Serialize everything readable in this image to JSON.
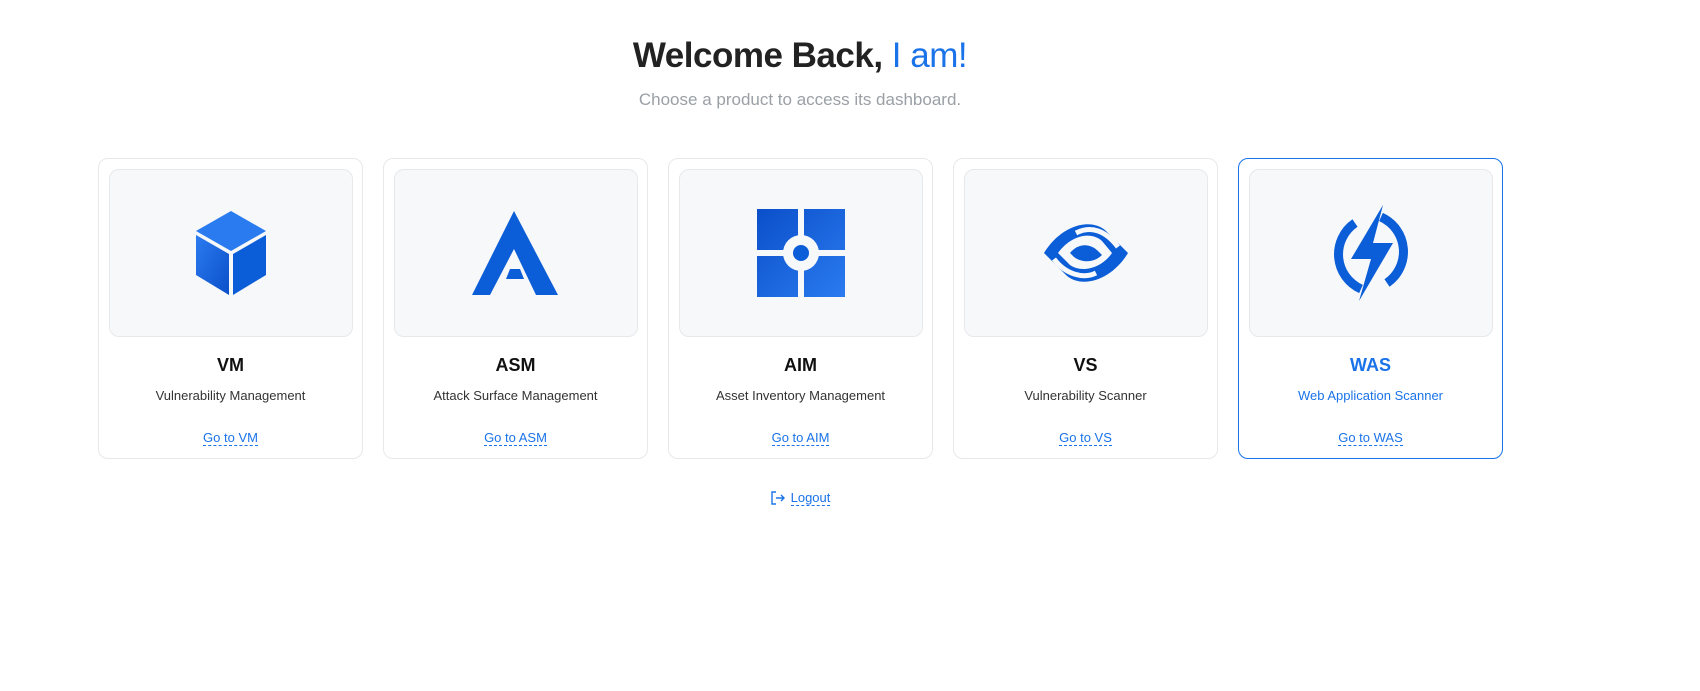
{
  "header": {
    "title_prefix": "Welcome Back,",
    "title_accent": "I am!",
    "subtitle": "Choose a product to access its dashboard."
  },
  "products": [
    {
      "name": "VM",
      "description": "Vulnerability Management",
      "link": "Go to VM",
      "icon": "cube-icon"
    },
    {
      "name": "ASM",
      "description": "Attack Surface Management",
      "link": "Go to ASM",
      "icon": "asm-logo-icon"
    },
    {
      "name": "AIM",
      "description": "Asset Inventory Management",
      "link": "Go to AIM",
      "icon": "grid-target-icon"
    },
    {
      "name": "VS",
      "description": "Vulnerability Scanner",
      "link": "Go to VS",
      "icon": "eye-scan-icon"
    },
    {
      "name": "WAS",
      "description": "Web Application Scanner",
      "link": "Go to WAS",
      "icon": "lightning-icon",
      "selected": true
    }
  ],
  "logout": {
    "label": "Logout",
    "icon": "logout-icon"
  },
  "colors": {
    "accent": "#1a73e8",
    "icon_blue": "#0b5ed7"
  }
}
